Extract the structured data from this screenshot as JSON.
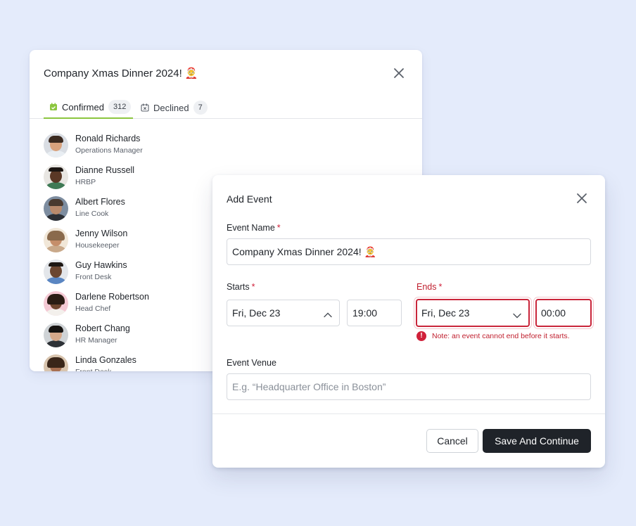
{
  "guest_dialog": {
    "title": "Company Xmas Dinner 2024! 🤶",
    "tabs": [
      {
        "label": "Confirmed",
        "count": "312",
        "icon": "calendar-check-icon",
        "active": true
      },
      {
        "label": "Declined",
        "count": "7",
        "icon": "calendar-x-icon",
        "active": false
      }
    ],
    "people": [
      {
        "name": "Ronald Richards",
        "role": "Operations Manager"
      },
      {
        "name": "Dianne Russell",
        "role": "HRBP"
      },
      {
        "name": "Albert Flores",
        "role": "Line Cook"
      },
      {
        "name": "Jenny Wilson",
        "role": "Housekeeper"
      },
      {
        "name": "Guy Hawkins",
        "role": "Front Desk"
      },
      {
        "name": "Darlene Robertson",
        "role": "Head Chef"
      },
      {
        "name": "Robert Chang",
        "role": "HR Manager"
      },
      {
        "name": "Linda Gonzales",
        "role": "Front Desk"
      }
    ]
  },
  "event_dialog": {
    "title": "Add Event",
    "event_name": {
      "label": "Event Name",
      "required_mark": "*",
      "value": "Company Xmas Dinner 2024! 🤶"
    },
    "starts": {
      "label": "Starts",
      "required_mark": "*",
      "date": "Fri, Dec 23",
      "time": "19:00"
    },
    "ends": {
      "label": "Ends",
      "required_mark": "*",
      "date": "Fri, Dec 23",
      "time": "00:00"
    },
    "error_note": "Note: an event cannot end before it starts.",
    "venue": {
      "label": "Event Venue",
      "placeholder": "E.g. “Headquarter Office in Boston”",
      "value": ""
    },
    "cancel_label": "Cancel",
    "save_label": "Save And Continue"
  },
  "colors": {
    "background": "#e4ebfb",
    "accent_green": "#8cc63f",
    "error_red": "#c9253a",
    "primary_button": "#1f2329"
  }
}
